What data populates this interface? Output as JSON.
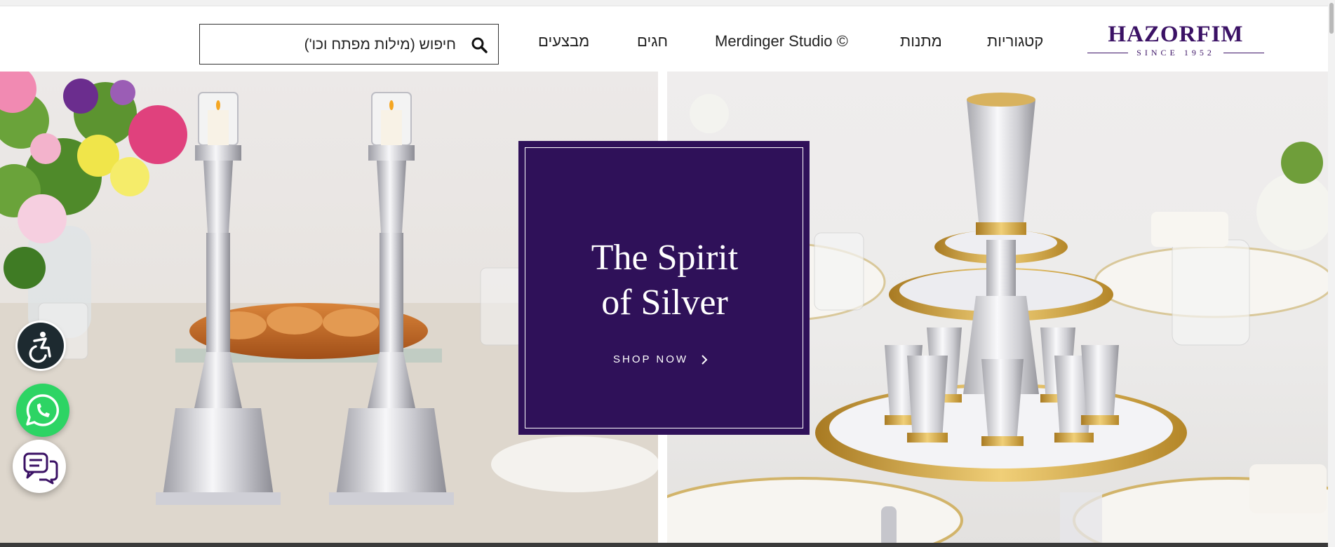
{
  "header": {
    "logo": {
      "name": "HAZORFIM",
      "since": "SINCE 1952",
      "color": "#3b1265"
    },
    "nav": [
      {
        "label": "קטגוריות"
      },
      {
        "label": "מתנות"
      },
      {
        "label": "Merdinger Studio ©"
      },
      {
        "label": "חגים"
      },
      {
        "label": "מבצעים"
      }
    ],
    "search": {
      "placeholder": "חיפוש (מילות מפתח וכו')",
      "value": "",
      "icon": "search-icon"
    }
  },
  "hero": {
    "left_image": "silver-candlesticks-shabbat-table",
    "right_image": "silver-kiddush-fountain-set",
    "promo": {
      "title_line1": "The Spirit",
      "title_line2": "of Silver",
      "cta_label": "SHOP NOW",
      "cta_icon": "chevron-right-icon",
      "background": "#2f1159"
    }
  },
  "floating_buttons": [
    {
      "name": "accessibility-button",
      "icon": "accessibility-icon",
      "color": "#1d2a30"
    },
    {
      "name": "whatsapp-button",
      "icon": "whatsapp-icon",
      "color": "#2dd464"
    },
    {
      "name": "chat-button",
      "icon": "chat-bubbles-icon",
      "color": "#ffffff"
    }
  ]
}
